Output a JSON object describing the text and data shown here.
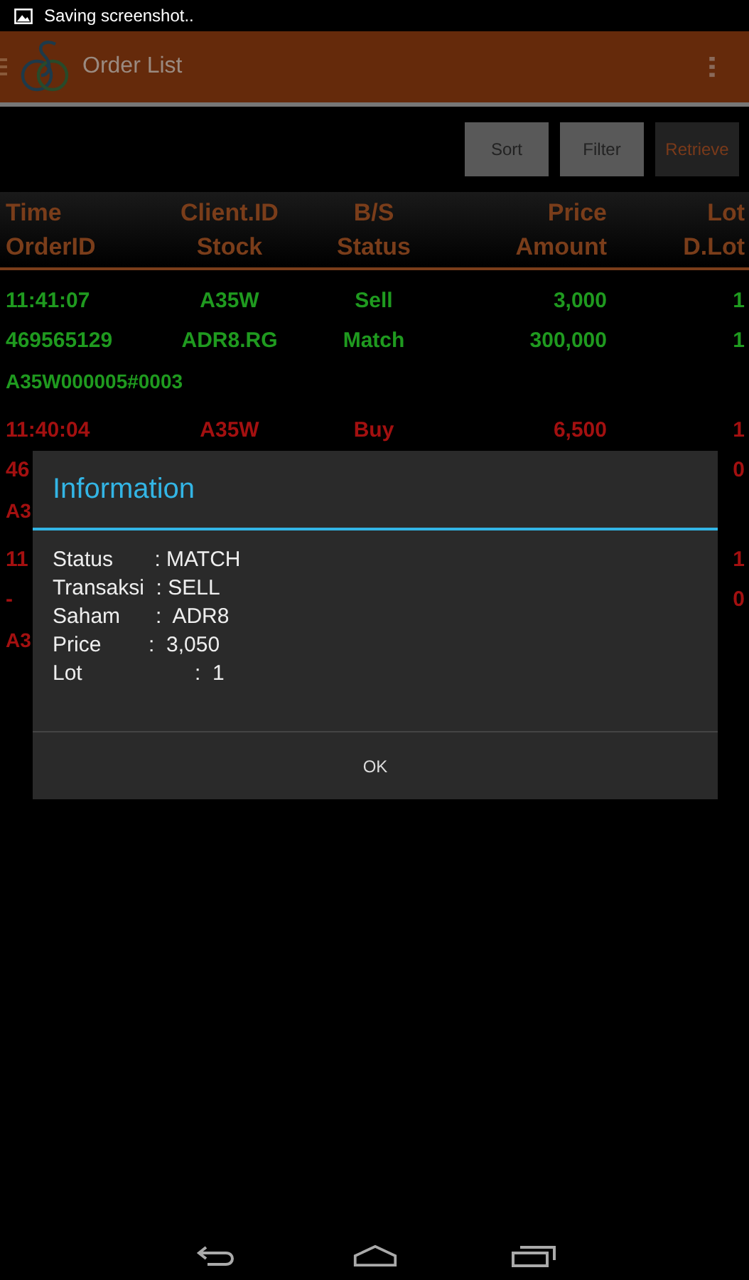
{
  "status_bar": {
    "notification": "Saving screenshot.."
  },
  "action_bar": {
    "title": "Order List"
  },
  "buttons": [
    {
      "label": "Sort",
      "disabled": false
    },
    {
      "label": "Filter",
      "disabled": false
    },
    {
      "label": "Retrieve",
      "disabled": true
    }
  ],
  "table": {
    "columns": [
      [
        "Time",
        "OrderID"
      ],
      [
        "Client.ID",
        "Stock"
      ],
      [
        "B/S",
        "Status"
      ],
      [
        "Price",
        "Amount"
      ],
      [
        "Lot",
        "D.Lot"
      ]
    ],
    "rows": [
      {
        "color": "#1f9a1f",
        "top": {
          "time": "11:41:07",
          "client_id": "A35W",
          "side": "Sell",
          "price": "3,000",
          "lot": "1"
        },
        "bottom": {
          "order_id": "469565129",
          "stock": "ADR8.RG",
          "status": "Match",
          "amount": "300,000",
          "d_lot": "1"
        },
        "ref": "A35W000005#0003"
      },
      {
        "color": "#a31010",
        "top": {
          "time": "11:40:04",
          "client_id": "A35W",
          "side": "Buy",
          "price": "6,500",
          "lot": "1"
        },
        "bottom": {
          "order_id": "46",
          "d_lot": "0"
        },
        "ref": "A3"
      },
      {
        "color": "#a31010",
        "top": {
          "time": "11",
          "lot": "1"
        },
        "bottom": {
          "order_id": "-",
          "d_lot": "0"
        },
        "ref": "A3"
      }
    ]
  },
  "dialog": {
    "title": "Information",
    "lines": [
      "Status       : MATCH",
      "Transaksi  : SELL",
      "Saham      :  ADR8",
      "Price        :  3,050",
      "Lot                   :  1"
    ],
    "button": "OK"
  }
}
